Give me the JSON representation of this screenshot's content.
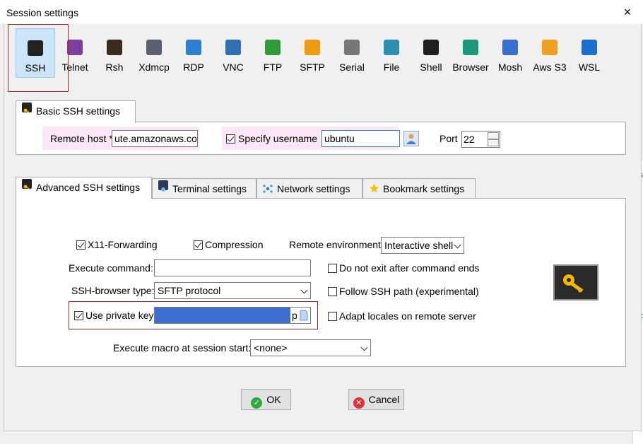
{
  "window": {
    "title": "Session settings",
    "close_glyph": "×"
  },
  "toolbar": {
    "items": [
      {
        "label": "SSH",
        "icon": "ssh-key-icon",
        "color": "#222222"
      },
      {
        "label": "Telnet",
        "icon": "telnet-icon",
        "color": "#7b3fa0"
      },
      {
        "label": "Rsh",
        "icon": "rsh-icon",
        "color": "#3a2a1a"
      },
      {
        "label": "Xdmcp",
        "icon": "xdmcp-icon",
        "color": "#5a6070"
      },
      {
        "label": "RDP",
        "icon": "rdp-icon",
        "color": "#2d7fd0"
      },
      {
        "label": "VNC",
        "icon": "vnc-icon",
        "color": "#2d6fb0"
      },
      {
        "label": "FTP",
        "icon": "ftp-icon",
        "color": "#2f9a3a"
      },
      {
        "label": "SFTP",
        "icon": "sftp-icon",
        "color": "#f09a10"
      },
      {
        "label": "Serial",
        "icon": "serial-icon",
        "color": "#777777"
      },
      {
        "label": "File",
        "icon": "file-icon",
        "color": "#2a8fb0"
      },
      {
        "label": "Shell",
        "icon": "shell-icon",
        "color": "#1e1e1e"
      },
      {
        "label": "Browser",
        "icon": "browser-icon",
        "color": "#1a9a7a"
      },
      {
        "label": "Mosh",
        "icon": "mosh-icon",
        "color": "#3a6fd0"
      },
      {
        "label": "Aws S3",
        "icon": "aws-s3-icon",
        "color": "#f0a020"
      },
      {
        "label": "WSL",
        "icon": "wsl-icon",
        "color": "#1a6fd0"
      }
    ],
    "selected": "SSH"
  },
  "basic": {
    "tab_label": "Basic SSH settings",
    "remote_host_label": "Remote host *",
    "remote_host_value": "ute.amazonaws.com",
    "specify_username_label": "Specify username",
    "specify_username_checked": true,
    "username_value": "ubuntu",
    "port_label": "Port",
    "port_value": "22"
  },
  "tabs": [
    {
      "label": "Advanced SSH settings",
      "icon": "key-icon"
    },
    {
      "label": "Terminal settings",
      "icon": "terminal-icon"
    },
    {
      "label": "Network settings",
      "icon": "network-icon"
    },
    {
      "label": "Bookmark settings",
      "icon": "star-icon"
    }
  ],
  "advanced": {
    "x11_label": "X11-Forwarding",
    "compression_label": "Compression",
    "remote_env_label": "Remote environment:",
    "remote_env_value": "Interactive shell",
    "exec_command_label": "Execute command:",
    "exec_command_value": "",
    "do_not_exit_label": "Do not exit after command ends",
    "ssh_browser_label": "SSH-browser type:",
    "ssh_browser_value": "SFTP protocol",
    "follow_ssh_label": "Follow SSH path (experimental)",
    "private_key_label": "Use private key",
    "private_key_value_suffix": "p",
    "adapt_locales_label": "Adapt locales on remote server",
    "macro_label": "Execute macro at session start:",
    "macro_value": "<none>"
  },
  "buttons": {
    "ok": "OK",
    "cancel": "Cancel"
  },
  "background": {
    "fragment_1": "ss",
    "fragment_2": "Eq"
  },
  "colors": {
    "accent": "#3c6fd0",
    "highlight_outline": "#a12828",
    "selected_tool": "#cce4f7"
  }
}
